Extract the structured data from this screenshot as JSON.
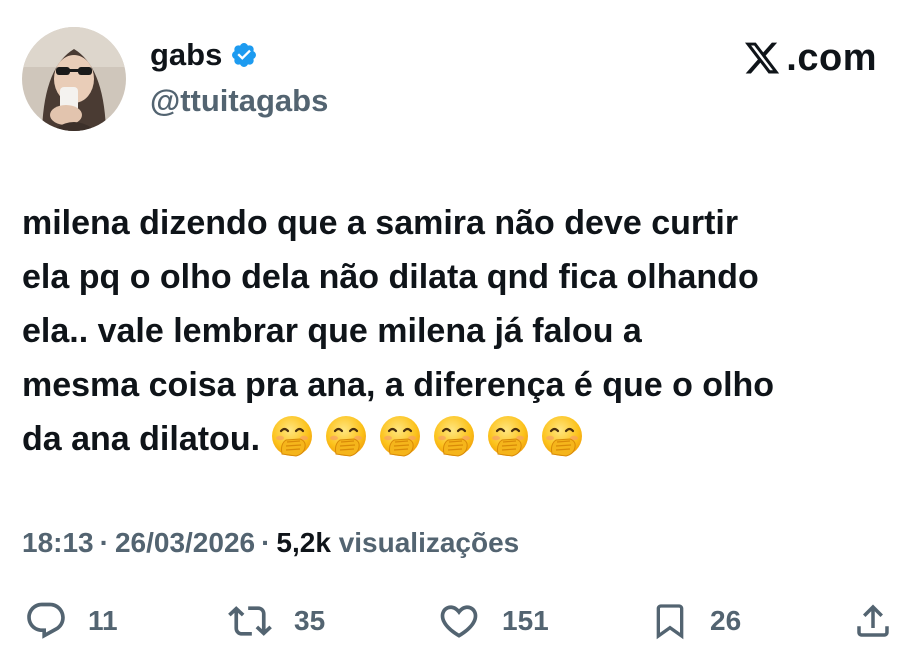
{
  "author": {
    "display_name": "gabs",
    "handle": "@ttuitagabs",
    "verified": true,
    "verified_color": "#1d9bf0"
  },
  "brand": {
    "text": ".com",
    "icon": "x-logo-icon"
  },
  "tweet": {
    "lines": [
      "milena dizendo que a samira não deve curtir",
      "ela pq o olho dela não dilata qnd fica olhando",
      "ela.. vale lembrar que milena já falou a",
      "mesma coisa pra ana, a diferença é que o olho",
      "da ana dilatou."
    ],
    "emojis": [
      "face-with-hand-over-mouth",
      "face-with-hand-over-mouth",
      "face-with-hand-over-mouth",
      "face-with-hand-over-mouth",
      "face-with-hand-over-mouth",
      "face-with-hand-over-mouth"
    ]
  },
  "meta": {
    "time": "18:13",
    "date": "26/03/2026",
    "views_count": "5,2k",
    "views_label": "visualizações",
    "separator": "·"
  },
  "actions": {
    "replies": "11",
    "reposts": "35",
    "likes": "151",
    "bookmarks": "26"
  },
  "colors": {
    "text": "#0f1419",
    "secondary": "#536471",
    "verified": "#1d9bf0"
  }
}
